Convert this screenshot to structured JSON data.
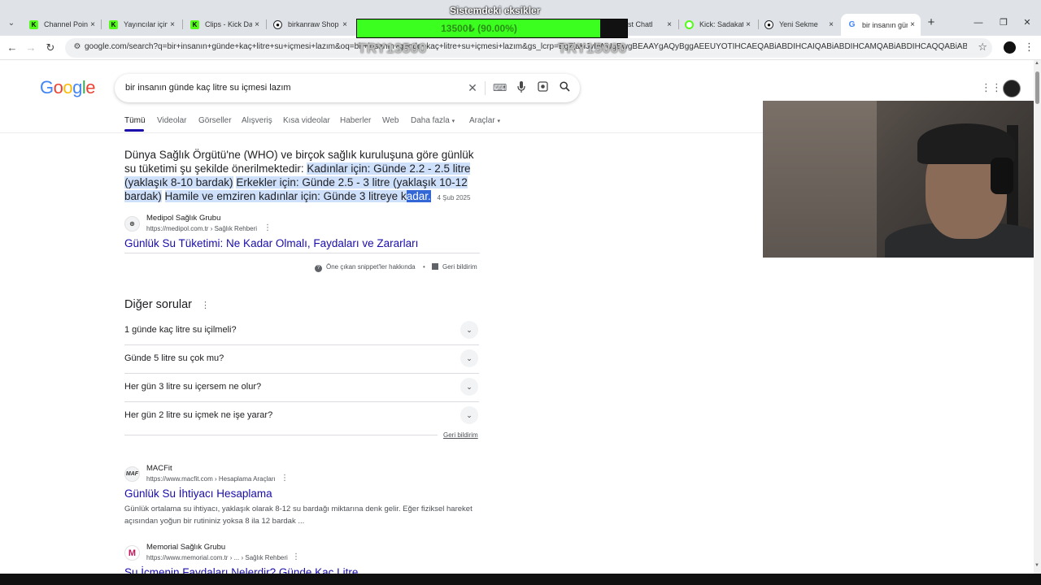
{
  "browser": {
    "tabs": [
      {
        "label": "Channel Points",
        "favicon_color": "#53fc18",
        "favicon_glyph": "K"
      },
      {
        "label": "Yayıncılar için K",
        "favicon_color": "#53fc18",
        "favicon_glyph": "K"
      },
      {
        "label": "Clips - Kick Da",
        "favicon_color": "#53fc18",
        "favicon_glyph": "K"
      },
      {
        "label": "birkanraw Shop",
        "favicon_color": "#24292f",
        "favicon_glyph": "●"
      },
      {
        "label": "est Chatl",
        "favicon_color": "#5b5bd6",
        "favicon_glyph": ""
      },
      {
        "label": "Kick: Sadakat p",
        "favicon_color": "#53fc18",
        "favicon_glyph": "○"
      },
      {
        "label": "Yeni Sekme",
        "favicon_color": "#24292f",
        "favicon_glyph": "●"
      },
      {
        "label": "bir insanın gün",
        "favicon_color": "#4285f4",
        "favicon_glyph": "G"
      }
    ],
    "tab_close": "×",
    "url": "google.com/search?q=bir+insanın+günde+kaç+litre+su+içmesi+lazım&oq=bir+insanın+günde+kaç+litre+su+içmesi+lazım&gs_lcrp=EgZjaHJvbWUqBwgBEAAYgAQyBggAEEUYOTIHCAEQABiABDIHCAIQABiABDIHCAMQABiABDIHCAQQABiABDIHCAUQABiABDIHCAYQABiABDIHCAcQABiABD..."
  },
  "overlay": {
    "title": "Sistemdeki eksikler",
    "bar_text": "13500₺ (90.00%)",
    "progress": 0.9,
    "amount_left": "TRY13500",
    "amount_right": "TRY15000"
  },
  "google": {
    "logo": "Google",
    "query": "bir insanın günde kaç litre su içmesi lazım",
    "filters": [
      "Tümü",
      "Videolar",
      "Görseller",
      "Alışveriş",
      "Kısa videolar",
      "Haberler",
      "Web",
      "Daha fazla",
      "Araçlar"
    ],
    "snippet": {
      "intro": "Dünya Sağlık Örgütü'ne (WHO) ve birçok sağlık kuruluşuna göre günlük su tüketimi şu şekilde önerilmektedir:",
      "women": "Kadınlar için: Günde 2.2 - 2.5 litre (yaklaşık 8-10 bardak)",
      "men": "Erkekler için: Günde 2.5 - 3 litre (yaklaşık 10-12 bardak)",
      "pregnant_pre": "Hamile ve emziren kadınlar için: Günde 3 litreye k",
      "pregnant_sel": "adar.",
      "date": "4 Şub 2025",
      "source_name": "Medipol Sağlık Grubu",
      "source_url": "https://medipol.com.tr › Sağlık Rehberi",
      "title": "Günlük Su Tüketimi: Ne Kadar Olmalı, Faydaları ve Zararları",
      "about": "Öne çıkan snippet'ler hakkında",
      "feedback": "Geri bildirim"
    },
    "paa": {
      "title": "Diğer sorular",
      "questions": [
        "1 günde kaç litre su içilmeli?",
        "Günde 5 litre su çok mu?",
        "Her gün 3 litre su içersem ne olur?",
        "Her gün 2 litre su içmek ne işe yarar?"
      ],
      "feedback": "Geri bildirim"
    },
    "results": [
      {
        "source_name": "MACFit",
        "source_url": "https://www.macfit.com › Hesaplama Araçları",
        "title": "Günlük Su İhtiyacı Hesaplama",
        "desc": "Günlük ortalama su ihtiyacı, yaklaşık olarak 8-12 su bardağı miktarına denk gelir. Eğer fiziksel hareket açısından yoğun bir rutininiz yoksa 8 ila 12 bardak ..."
      },
      {
        "source_name": "Memorial Sağlık Grubu",
        "source_url": "https://www.memorial.com.tr › ... › Sağlık Rehberi",
        "title": "Su İçmenin Faydaları Nelerdir? Günde Kaç Litre ..."
      }
    ]
  }
}
